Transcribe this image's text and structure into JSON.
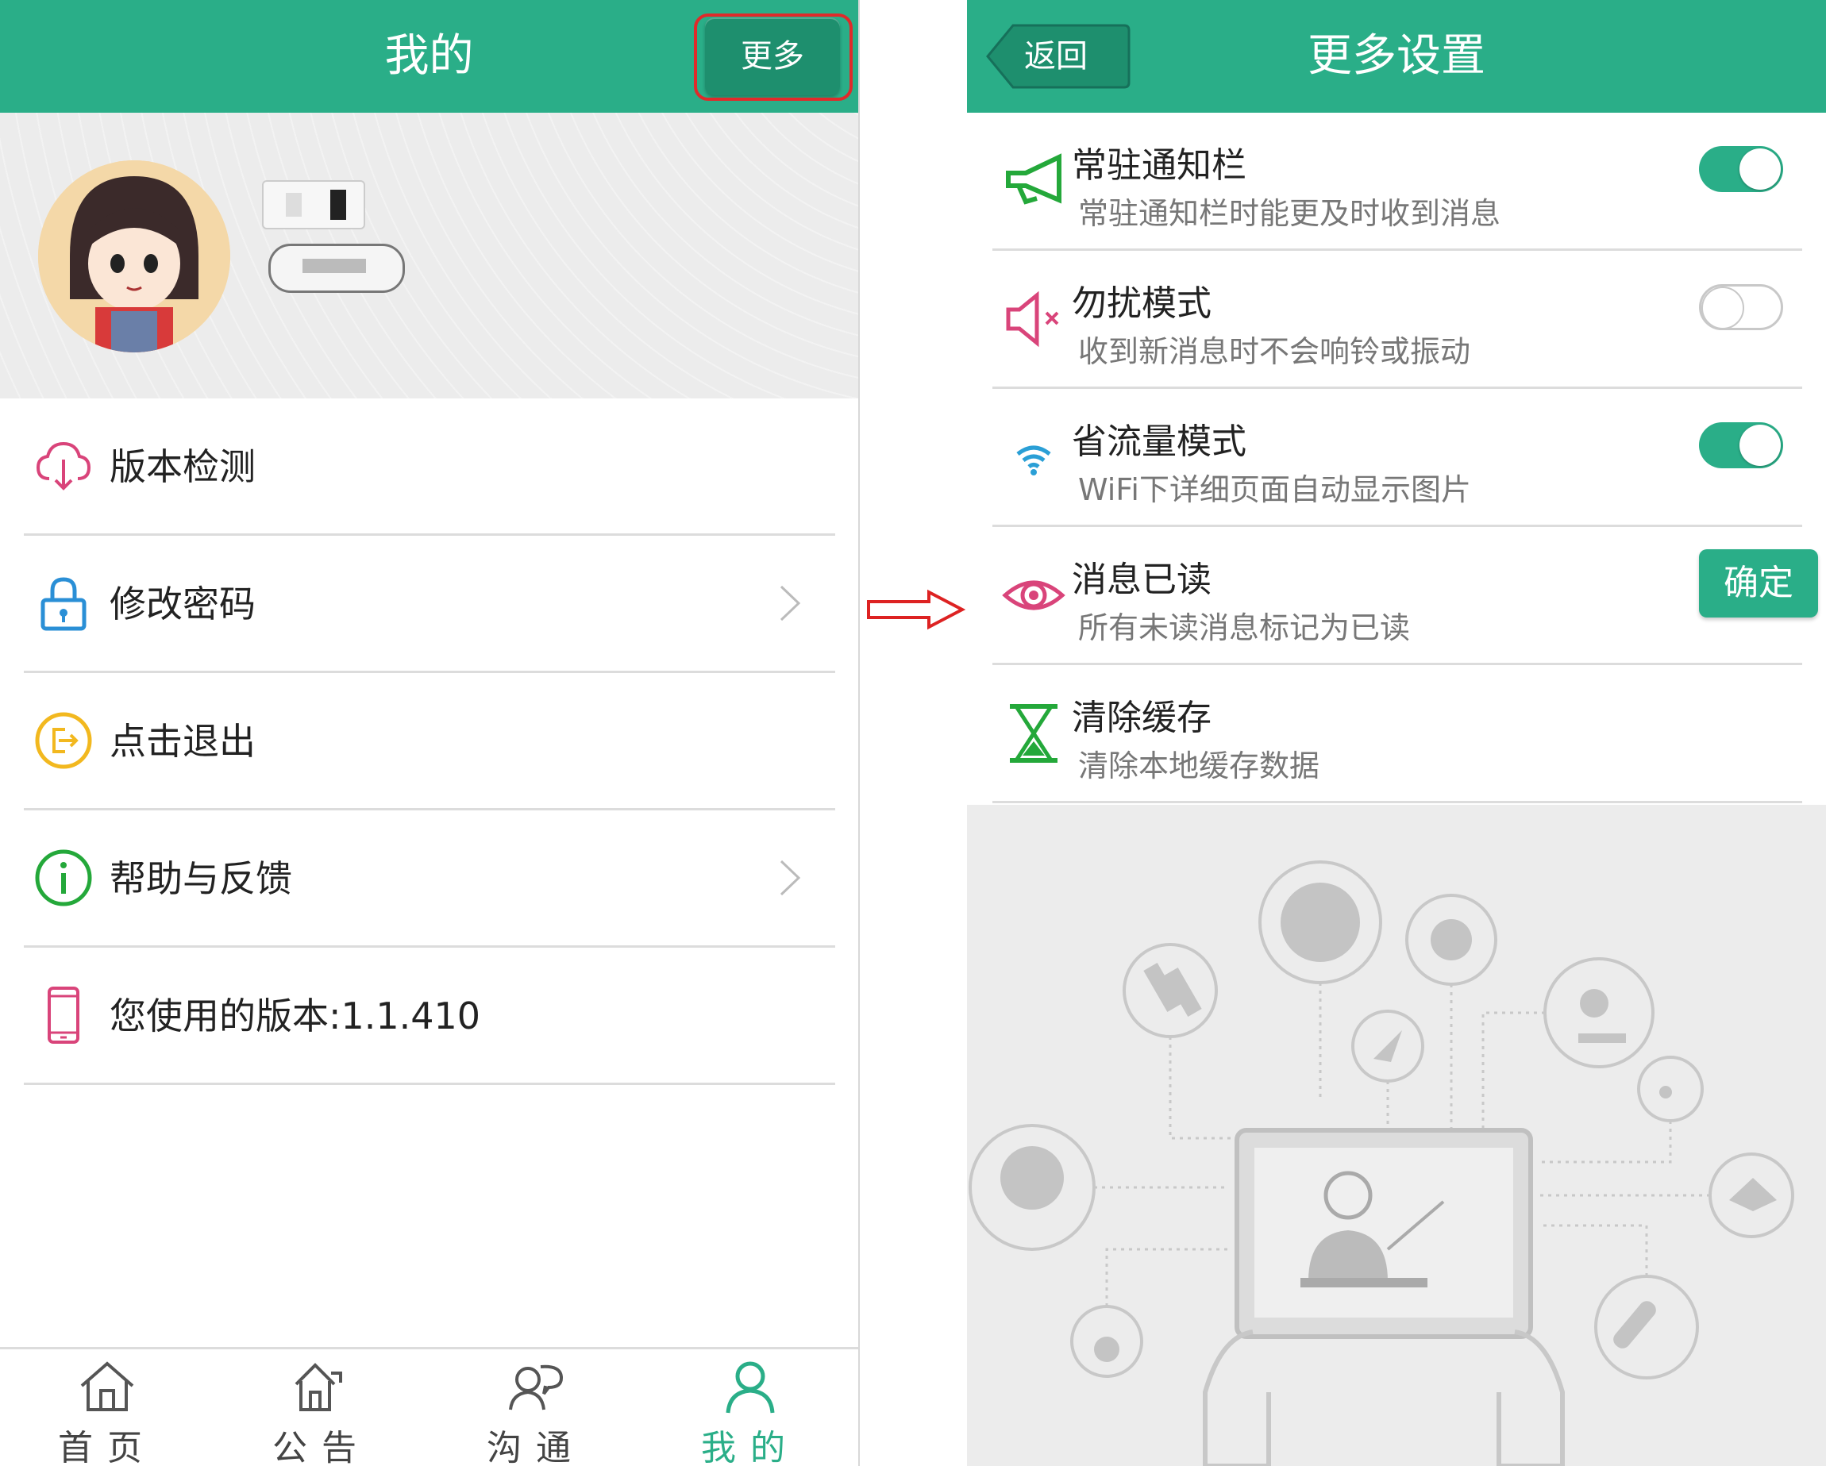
{
  "left": {
    "header": {
      "title": "我的",
      "more_label": "更多"
    },
    "menu": [
      {
        "label": "版本检测",
        "icon": "cloud-download-icon",
        "chevron": false
      },
      {
        "label": "修改密码",
        "icon": "lock-icon",
        "chevron": true
      },
      {
        "label": "点击退出",
        "icon": "logout-icon",
        "chevron": false
      },
      {
        "label": "帮助与反馈",
        "icon": "info-icon",
        "chevron": true
      },
      {
        "label": "您使用的版本:1.1.410",
        "icon": "phone-icon",
        "chevron": false
      }
    ],
    "tabs": [
      {
        "label": "首页",
        "icon": "home-icon",
        "active": false
      },
      {
        "label": "公告",
        "icon": "notice-house-icon",
        "active": false
      },
      {
        "label": "沟通",
        "icon": "chat-people-icon",
        "active": false
      },
      {
        "label": "我的",
        "icon": "person-icon",
        "active": true
      }
    ]
  },
  "right": {
    "header": {
      "title": "更多设置",
      "back_label": "返回"
    },
    "settings": [
      {
        "title": "常驻通知栏",
        "desc": "常驻通知栏时能更及时收到消息",
        "icon": "megaphone-icon",
        "control": "toggle",
        "on": true
      },
      {
        "title": "勿扰模式",
        "desc": "收到新消息时不会响铃或振动",
        "icon": "mute-speaker-icon",
        "control": "toggle",
        "on": false
      },
      {
        "title": "省流量模式",
        "desc": "WiFi下详细页面自动显示图片",
        "icon": "wifi-icon",
        "control": "toggle",
        "on": true
      },
      {
        "title": "消息已读",
        "desc": "所有未读消息标记为已读",
        "icon": "eye-icon",
        "control": "button",
        "button_label": "确定"
      },
      {
        "title": "清除缓存",
        "desc": "清除本地缓存数据",
        "icon": "hourglass-icon",
        "control": "none"
      }
    ]
  },
  "colors": {
    "accent": "#2aae88",
    "highlight": "#e02a2a"
  }
}
